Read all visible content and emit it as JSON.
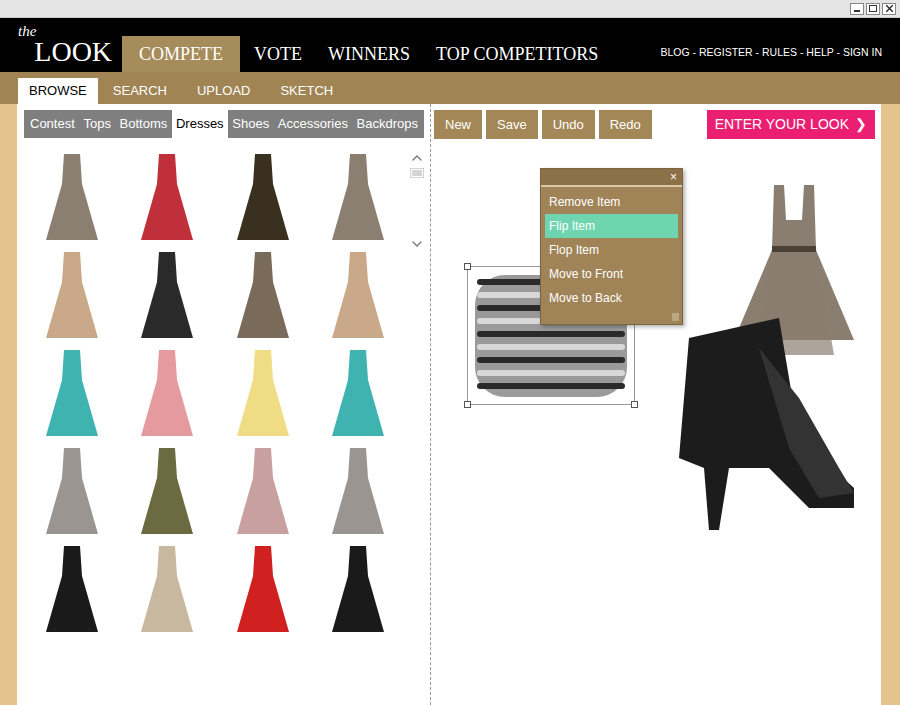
{
  "logo": {
    "small": "the",
    "large": "LOOK"
  },
  "nav": [
    {
      "label": "COMPETE",
      "selected": true
    },
    {
      "label": "VOTE",
      "selected": false
    },
    {
      "label": "WINNERS",
      "selected": false
    },
    {
      "label": "TOP COMPETITORS",
      "selected": false
    }
  ],
  "utility_links": "BLOG - REGISTER - RULES - HELP - SIGN IN",
  "subtabs": [
    {
      "label": "BROWSE",
      "selected": true
    },
    {
      "label": "SEARCH",
      "selected": false
    },
    {
      "label": "UPLOAD",
      "selected": false
    },
    {
      "label": "SKETCH",
      "selected": false
    }
  ],
  "categories": [
    {
      "label": "Contest",
      "selected": false
    },
    {
      "label": "Tops",
      "selected": false
    },
    {
      "label": "Bottoms",
      "selected": false
    },
    {
      "label": "Dresses",
      "selected": true
    },
    {
      "label": "Shoes",
      "selected": false
    },
    {
      "label": "Accessories",
      "selected": false
    },
    {
      "label": "Backdrops",
      "selected": false
    }
  ],
  "products": [
    {
      "color": "#8a7f70"
    },
    {
      "color": "#c0303a"
    },
    {
      "color": "#3a3020"
    },
    {
      "color": "#8a7f70"
    },
    {
      "color": "#c9a98a"
    },
    {
      "color": "#2a2a2a"
    },
    {
      "color": "#7a6a5a"
    },
    {
      "color": "#c9a98a"
    },
    {
      "color": "#3fb3b0"
    },
    {
      "color": "#e59aa0"
    },
    {
      "color": "#f0dc84"
    },
    {
      "color": "#3fb3b0"
    },
    {
      "color": "#9a9590"
    },
    {
      "color": "#6b6a40"
    },
    {
      "color": "#c9a0a0"
    },
    {
      "color": "#9a9590"
    },
    {
      "color": "#1a1a1a"
    },
    {
      "color": "#c8b8a0"
    },
    {
      "color": "#d02020"
    },
    {
      "color": "#1a1a1a"
    }
  ],
  "toolbar": {
    "buttons": [
      "New",
      "Save",
      "Undo",
      "Redo"
    ],
    "enter": "ENTER YOUR LOOK",
    "enter_icon": "❯"
  },
  "canvas": {
    "items": [
      {
        "kind": "bracelet",
        "selected": true,
        "color": "#9a9a9a"
      },
      {
        "kind": "dress",
        "selected": false,
        "color": "#8a7e70"
      },
      {
        "kind": "boot",
        "selected": false,
        "color": "#1c1c1c"
      }
    ]
  },
  "context_menu": {
    "close": "×",
    "items": [
      {
        "label": "Remove Item",
        "selected": false
      },
      {
        "label": "Flip Item",
        "selected": true
      },
      {
        "label": "Flop Item",
        "selected": false
      },
      {
        "label": "Move to Front",
        "selected": false
      },
      {
        "label": "Move to Back",
        "selected": false
      }
    ]
  }
}
